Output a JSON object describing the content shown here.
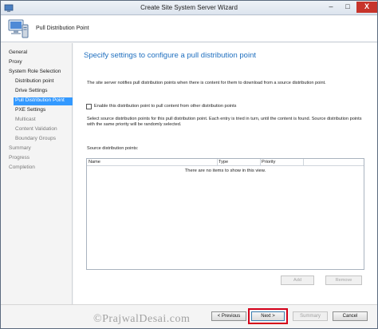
{
  "window": {
    "title": "Create Site System Server Wizard",
    "controls": {
      "minimize": "–",
      "maximize": "□",
      "close": "X"
    }
  },
  "header": {
    "icon": "server-computer-icon",
    "title": "Pull Distribution Point"
  },
  "nav": {
    "items": [
      {
        "label": "General",
        "level": 0,
        "state": "normal"
      },
      {
        "label": "Proxy",
        "level": 0,
        "state": "normal"
      },
      {
        "label": "System Role Selection",
        "level": 0,
        "state": "normal"
      },
      {
        "label": "Distribution point",
        "level": 1,
        "state": "normal"
      },
      {
        "label": "Drive Settings",
        "level": 1,
        "state": "normal"
      },
      {
        "label": "Pull Distribution Point",
        "level": 1,
        "state": "selected"
      },
      {
        "label": "PXE Settings",
        "level": 1,
        "state": "normal"
      },
      {
        "label": "Multicast",
        "level": 1,
        "state": "inactive"
      },
      {
        "label": "Content Validation",
        "level": 1,
        "state": "inactive"
      },
      {
        "label": "Boundary Groups",
        "level": 1,
        "state": "inactive"
      },
      {
        "label": "Summary",
        "level": 0,
        "state": "inactive"
      },
      {
        "label": "Progress",
        "level": 0,
        "state": "inactive"
      },
      {
        "label": "Completion",
        "level": 0,
        "state": "inactive"
      }
    ]
  },
  "main": {
    "page_title": "Specify settings to configure a pull distribution point",
    "description": "The site server notifies pull distribution points when there is content for them to download from a source distribution point.",
    "enable_checkbox": {
      "label": "Enable this distribution point to pull content from other distribution points",
      "checked": false
    },
    "info_text": "Select source distribution points for this pull distribution point. Each entry is tried in turn, until the content is found. Source distribution points with the same priority will be randomly selected.",
    "source_label": "Source distribution points:",
    "table": {
      "columns": [
        "Name",
        "Type",
        "Priority"
      ],
      "empty_message": "There are no items to show in this view."
    },
    "add_button": "Add",
    "remove_button": "Remove"
  },
  "footer": {
    "previous": "< Previous",
    "next": "Next >",
    "summary": "Summary",
    "cancel": "Cancel"
  },
  "watermark": "©PrajwalDesai.com",
  "colors": {
    "accent": "#3399ff",
    "title_blue": "#1f6fbf",
    "highlight_red": "#d4001a",
    "close_red": "#c7342b"
  }
}
